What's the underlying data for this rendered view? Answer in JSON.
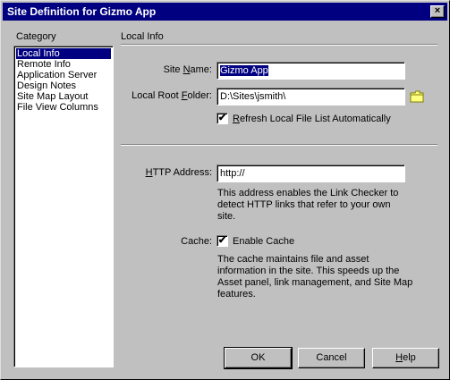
{
  "window": {
    "title": "Site Definition for Gizmo App",
    "close_glyph": "×"
  },
  "sidebar": {
    "heading": "Category",
    "items": [
      {
        "label": "Local Info",
        "selected": true
      },
      {
        "label": "Remote Info"
      },
      {
        "label": "Application Server"
      },
      {
        "label": "Design Notes"
      },
      {
        "label": "Site Map Layout"
      },
      {
        "label": "File View Columns"
      }
    ]
  },
  "main": {
    "section_title": "Local Info",
    "site_name": {
      "label_pre": "Site ",
      "label_key": "N",
      "label_post": "ame:",
      "value": "Gizmo App"
    },
    "local_root": {
      "label_pre": "Local Root ",
      "label_key": "F",
      "label_post": "older:",
      "value": "D:\\Sites\\jsmith\\",
      "icon": "folder-icon"
    },
    "refresh": {
      "checked": true,
      "check_glyph": "✔",
      "label_key": "R",
      "label_post": "efresh Local File List Automatically"
    },
    "http": {
      "label_key": "H",
      "label_post": "TTP Address:",
      "value": "http://",
      "description": "This address enables the Link Checker to detect HTTP links that refer to your own site."
    },
    "cache": {
      "label": "Cache:",
      "checked": true,
      "check_glyph": "✔",
      "checkbox_label": "Enable Cache",
      "description": "The cache maintains file and asset information in the site.  This speeds up the Asset panel, link management, and Site Map features."
    }
  },
  "buttons": {
    "ok": "OK",
    "cancel": "Cancel",
    "help_key": "H",
    "help_post": "elp"
  }
}
